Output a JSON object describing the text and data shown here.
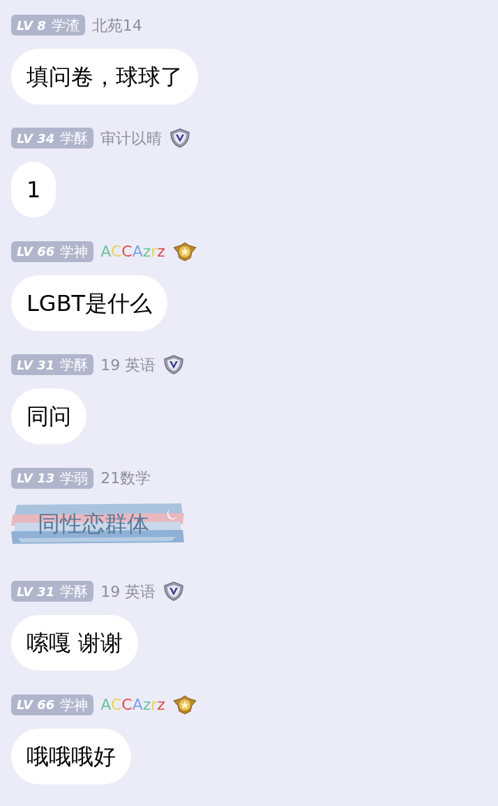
{
  "messages": [
    {
      "badge": {
        "level": "LV 8",
        "title": "学渣"
      },
      "name": [
        {
          "text": "北苑14"
        }
      ],
      "bubble": {
        "kind": "plain",
        "text": "填问卷，球球了"
      }
    },
    {
      "badge": {
        "level": "LV 34",
        "title": "学酥"
      },
      "name": [
        {
          "text": "审计以晴"
        }
      ],
      "medal": {
        "kind": "silver"
      },
      "bubble": {
        "kind": "plain",
        "text": "1"
      }
    },
    {
      "badge": {
        "level": "LV 66",
        "title": "学神"
      },
      "name": [
        {
          "text": "A",
          "color": "#6cc49c"
        },
        {
          "text": "C",
          "color": "#e6d35c"
        },
        {
          "text": "C",
          "color": "#e0484c"
        },
        {
          "text": "A",
          "color": "#7fa3e0"
        },
        {
          "text": "z",
          "color": "#6cc49c"
        },
        {
          "text": "r",
          "color": "#e6d35c"
        },
        {
          "text": "z",
          "color": "#e0484c"
        }
      ],
      "medal": {
        "kind": "gold"
      },
      "bubble": {
        "kind": "plain",
        "text": "LGBT是什么"
      }
    },
    {
      "badge": {
        "level": "LV 31",
        "title": "学酥"
      },
      "name": [
        {
          "text": "19 英语"
        }
      ],
      "medal": {
        "kind": "silver"
      },
      "bubble": {
        "kind": "plain",
        "text": "同问"
      }
    },
    {
      "badge": {
        "level": "LV 13",
        "title": "学弱"
      },
      "name": [
        {
          "text": "21数学"
        }
      ],
      "bubble": {
        "kind": "painted",
        "text": "同性恋群体"
      }
    },
    {
      "badge": {
        "level": "LV 31",
        "title": "学酥"
      },
      "name": [
        {
          "text": "19 英语"
        }
      ],
      "medal": {
        "kind": "silver"
      },
      "bubble": {
        "kind": "plain",
        "text": "嗦嘎 谢谢"
      }
    },
    {
      "badge": {
        "level": "LV 66",
        "title": "学神"
      },
      "name": [
        {
          "text": "A",
          "color": "#6cc49c"
        },
        {
          "text": "C",
          "color": "#e6d35c"
        },
        {
          "text": "C",
          "color": "#e0484c"
        },
        {
          "text": "A",
          "color": "#7fa3e0"
        },
        {
          "text": "z",
          "color": "#6cc49c"
        },
        {
          "text": "r",
          "color": "#e6d35c"
        },
        {
          "text": "z",
          "color": "#e0484c"
        }
      ],
      "medal": {
        "kind": "gold"
      },
      "bubble": {
        "kind": "plain",
        "text": "哦哦哦好"
      }
    }
  ]
}
